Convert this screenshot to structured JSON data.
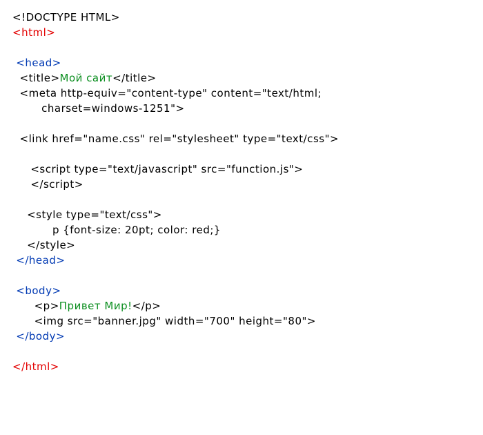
{
  "lines": [
    {
      "indent": 0,
      "segments": [
        {
          "cls": "c-black",
          "key": "t.0.0"
        }
      ]
    },
    {
      "indent": 0,
      "segments": [
        {
          "cls": "c-red",
          "key": "t.1.0"
        }
      ]
    },
    {
      "blank": true
    },
    {
      "indent": 1,
      "segments": [
        {
          "cls": "c-blue",
          "key": "t.3.0"
        }
      ]
    },
    {
      "indent": 2,
      "segments": [
        {
          "cls": "c-black",
          "key": "t.4.0"
        },
        {
          "cls": "c-green",
          "key": "t.4.1"
        },
        {
          "cls": "c-black",
          "key": "t.4.2"
        }
      ]
    },
    {
      "indent": 2,
      "segments": [
        {
          "cls": "c-black",
          "key": "t.5.0"
        }
      ]
    },
    {
      "indent": 8,
      "segments": [
        {
          "cls": "c-black",
          "key": "t.6.0"
        }
      ]
    },
    {
      "blank": true
    },
    {
      "indent": 2,
      "segments": [
        {
          "cls": "c-black",
          "key": "t.8.0"
        }
      ]
    },
    {
      "blank": true
    },
    {
      "indent": 5,
      "segments": [
        {
          "cls": "c-black",
          "key": "t.10.0"
        }
      ]
    },
    {
      "indent": 5,
      "segments": [
        {
          "cls": "c-black",
          "key": "t.11.0"
        }
      ]
    },
    {
      "blank": true
    },
    {
      "indent": 4,
      "segments": [
        {
          "cls": "c-black",
          "key": "t.13.0"
        }
      ]
    },
    {
      "indent": 11,
      "segments": [
        {
          "cls": "c-black",
          "key": "t.14.0"
        }
      ]
    },
    {
      "indent": 4,
      "segments": [
        {
          "cls": "c-black",
          "key": "t.15.0"
        }
      ]
    },
    {
      "indent": 1,
      "segments": [
        {
          "cls": "c-blue",
          "key": "t.16.0"
        }
      ]
    },
    {
      "blank": true
    },
    {
      "indent": 1,
      "segments": [
        {
          "cls": "c-blue",
          "key": "t.18.0"
        }
      ]
    },
    {
      "indent": 6,
      "segments": [
        {
          "cls": "c-black",
          "key": "t.19.0"
        },
        {
          "cls": "c-green",
          "key": "t.19.1"
        },
        {
          "cls": "c-black",
          "key": "t.19.2"
        }
      ]
    },
    {
      "indent": 6,
      "segments": [
        {
          "cls": "c-black",
          "key": "t.20.0"
        }
      ]
    },
    {
      "indent": 1,
      "segments": [
        {
          "cls": "c-blue",
          "key": "t.21.0"
        }
      ]
    },
    {
      "blank": true
    },
    {
      "indent": 0,
      "segments": [
        {
          "cls": "c-red",
          "key": "t.23.0"
        }
      ]
    }
  ],
  "t": {
    "0": {
      "0": "<!DOCTYPE HTML>"
    },
    "1": {
      "0": "<html>"
    },
    "3": {
      "0": "<head>"
    },
    "4": {
      "0": "<title>",
      "1": "Мой сайт",
      "2": "</title>"
    },
    "5": {
      "0": "<meta http-equiv=\"content-type\" content=\"text/html;"
    },
    "6": {
      "0": "charset=windows-1251\">"
    },
    "8": {
      "0": "<link href=\"name.css\" rel=\"stylesheet\" type=\"text/css\">"
    },
    "10": {
      "0": "<script type=\"text/javascript\" src=\"function.js\">"
    },
    "11": {
      "0": "</script>"
    },
    "13": {
      "0": "<style type=\"text/css\">"
    },
    "14": {
      "0": "p {font-size: 20pt; color: red;}"
    },
    "15": {
      "0": "</style>"
    },
    "16": {
      "0": "</head>"
    },
    "18": {
      "0": "<body>"
    },
    "19": {
      "0": "<p>",
      "1": "Привет Мир!",
      "2": "</p>"
    },
    "20": {
      "0": "<img src=\"banner.jpg\" width=\"700\" height=\"80\">"
    },
    "21": {
      "0": "</body>"
    },
    "23": {
      "0": "</html>"
    }
  },
  "meta": {
    "indentUnit": " "
  }
}
